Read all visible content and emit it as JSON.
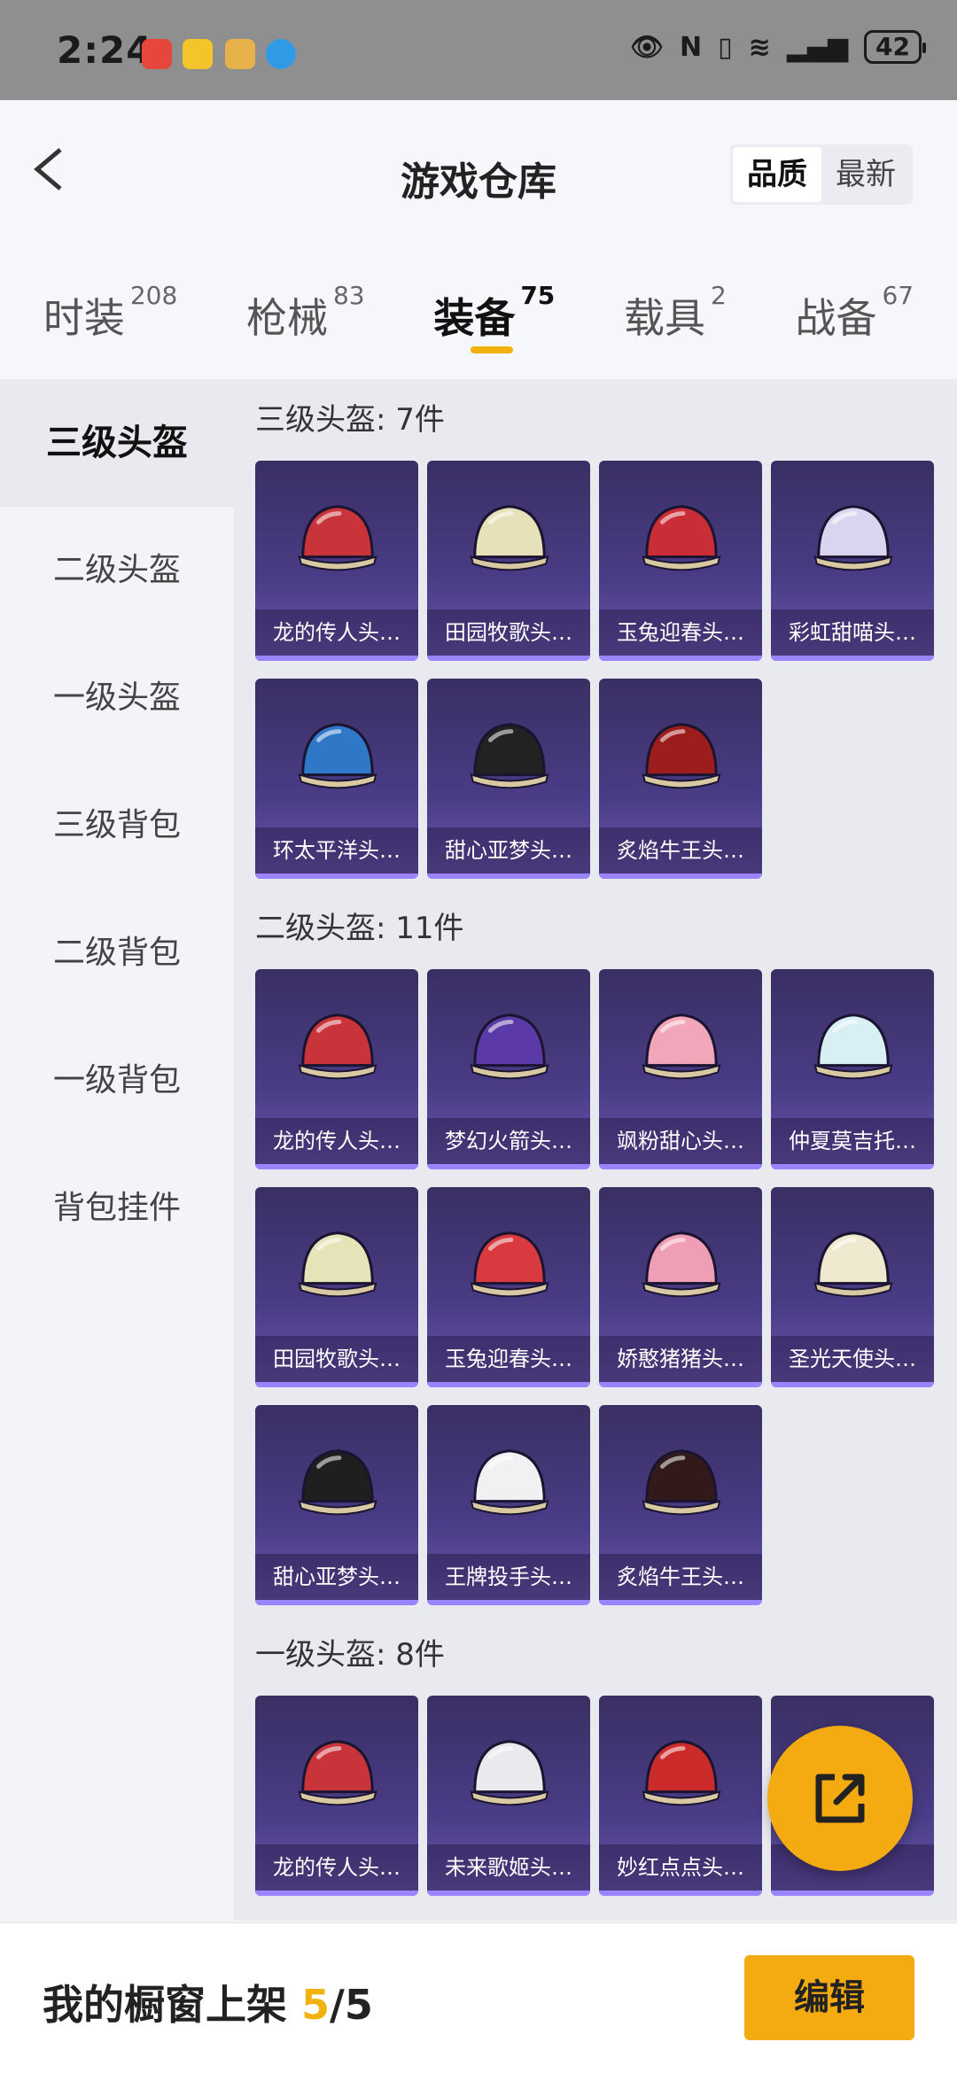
{
  "status_bar": {
    "time": "2:24",
    "battery": "42"
  },
  "header": {
    "title": "游戏仓库",
    "sort": [
      "品质",
      "最新"
    ]
  },
  "tabs": [
    {
      "label": "时装",
      "count": "208"
    },
    {
      "label": "枪械",
      "count": "83"
    },
    {
      "label": "装备",
      "count": "75",
      "active": true
    },
    {
      "label": "载具",
      "count": "2"
    },
    {
      "label": "战备",
      "count": "67"
    }
  ],
  "sidebar": [
    "三级头盔",
    "二级头盔",
    "一级头盔",
    "三级背包",
    "二级背包",
    "一级背包",
    "背包挂件"
  ],
  "sections": [
    {
      "title": "三级头盔: 7件",
      "items": [
        "龙的传人头…",
        "田园牧歌头…",
        "玉兔迎春头…",
        "彩虹甜喵头…",
        "环太平洋头…",
        "甜心亚梦头…",
        "炙焰牛王头…"
      ],
      "colors": [
        "#c8343a",
        "#e6e1b8",
        "#c92d36",
        "#d9d4ef",
        "#2f78c8",
        "#222222",
        "#9d1c1c"
      ]
    },
    {
      "title": "二级头盔: 11件",
      "items": [
        "龙的传人头…",
        "梦幻火箭头…",
        "飒粉甜心头…",
        "仲夏莫吉托…",
        "田园牧歌头…",
        "玉兔迎春头…",
        "娇憨猪猪头…",
        "圣光天使头…",
        "甜心亚梦头…",
        "王牌投手头…",
        "炙焰牛王头…"
      ],
      "colors": [
        "#c8343a",
        "#5b3aa7",
        "#f1a6b9",
        "#d8f0f4",
        "#e5e3b8",
        "#d83a3f",
        "#ef9eb5",
        "#efe9cf",
        "#1f1f1f",
        "#f1f1f4",
        "#321a1a"
      ]
    },
    {
      "title": "一级头盔: 8件",
      "items": [
        "龙的传人头…",
        "未来歌姬头…",
        "妙红点点头…",
        ""
      ],
      "colors": [
        "#c8343a",
        "#e9e9ee",
        "#cc2b2b",
        "#efe9d6"
      ]
    }
  ],
  "bottom": {
    "label": "我的橱窗上架",
    "current": "5",
    "sep": "/",
    "total": "5",
    "edit": "编辑"
  }
}
